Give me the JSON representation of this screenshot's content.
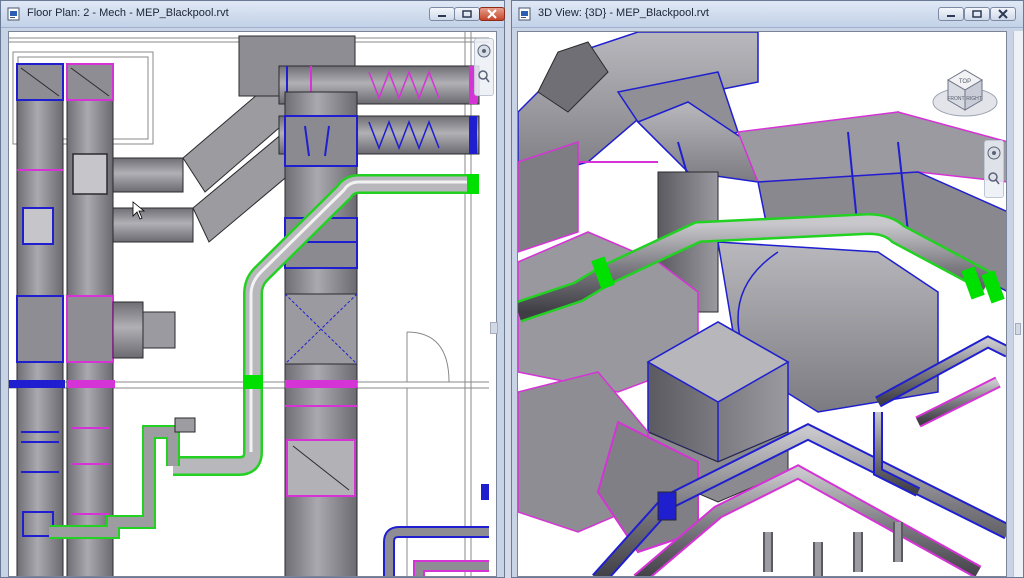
{
  "windows": {
    "floor_plan": {
      "title": "Floor Plan: 2 - Mech - MEP_Blackpool.rvt",
      "view_type": "floor-plan"
    },
    "view_3d": {
      "title": "3D View: {3D} - MEP_Blackpool.rvt",
      "view_type": "3d",
      "viewcube": {
        "labels": [
          "TOP",
          "FRONT",
          "RIGHT"
        ]
      }
    }
  },
  "icons": {
    "app": "revit-doc-icon",
    "minimize": "minimize-icon",
    "restore": "restore-icon",
    "close": "close-icon",
    "steering_wheel": "steering-wheel-icon",
    "zoom": "zoom-icon",
    "cursor": "mouse-pointer-icon"
  },
  "colors": {
    "duct": "#8f8f95",
    "duct_edge": "#2a2a2f",
    "duct_blue": "#1f1fd0",
    "duct_magenta": "#d633d6",
    "pipe_green": "#22d122",
    "highlight_green": "#00e000",
    "title_bar": "#c3d2e8",
    "close_red": "#c4452b"
  }
}
